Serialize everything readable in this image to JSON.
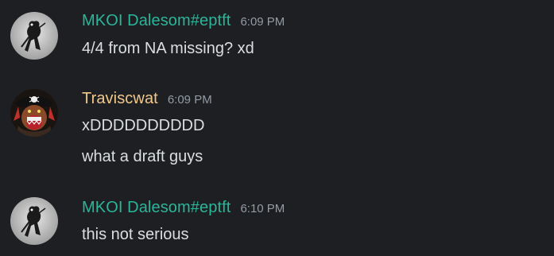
{
  "colors": {
    "background": "#1e1f22",
    "username_teal": "#2bb59a",
    "username_gold": "#f0c98a",
    "timestamp": "#949ba4",
    "text": "#dbdee1"
  },
  "messages": [
    {
      "author": "MKOI Dalesom#eptft",
      "time": "6:09 PM",
      "avatar_icon": "rat-avatar-icon",
      "lines": [
        "4/4 from NA missing? xd"
      ]
    },
    {
      "author": "Traviscwat",
      "time": "6:09 PM",
      "avatar_icon": "pirate-avatar-icon",
      "lines": [
        "xDDDDDDDDDD",
        "what a draft guys"
      ]
    },
    {
      "author": "MKOI Dalesom#eptft",
      "time": "6:10 PM",
      "avatar_icon": "rat-avatar-icon",
      "lines": [
        "this not serious"
      ]
    }
  ]
}
